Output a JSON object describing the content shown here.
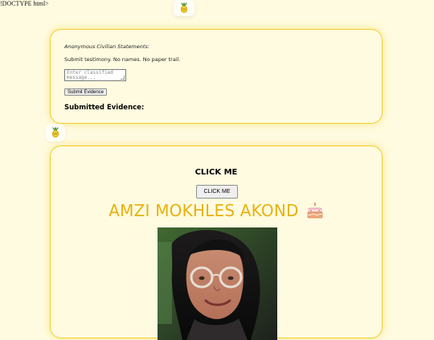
{
  "page": {
    "stray_text": "!DOCTYPE html>"
  },
  "icons": {
    "top_badge": "pineapple-emoji-icon",
    "mid_badge": "pineapple-emoji-icon",
    "cake": "birthday-cake-icon"
  },
  "testimony": {
    "heading": "Anonymous Civilian Statements:",
    "subtext": "Submit testimony. No names. No paper trail.",
    "textarea_placeholder": "Enter classified message...",
    "submit_label": "Submit Evidence",
    "evidence_heading": "Submitted Evidence:"
  },
  "birthday": {
    "click_heading": "CLICK ME",
    "click_button_label": "CLICK ME",
    "name": "AMZI MOKHLES AKOND",
    "photo_subject": "portrait-photo"
  },
  "colors": {
    "background": "#fffbe0",
    "card_border": "#f2cd2a",
    "name_color": "#e7b10d"
  }
}
